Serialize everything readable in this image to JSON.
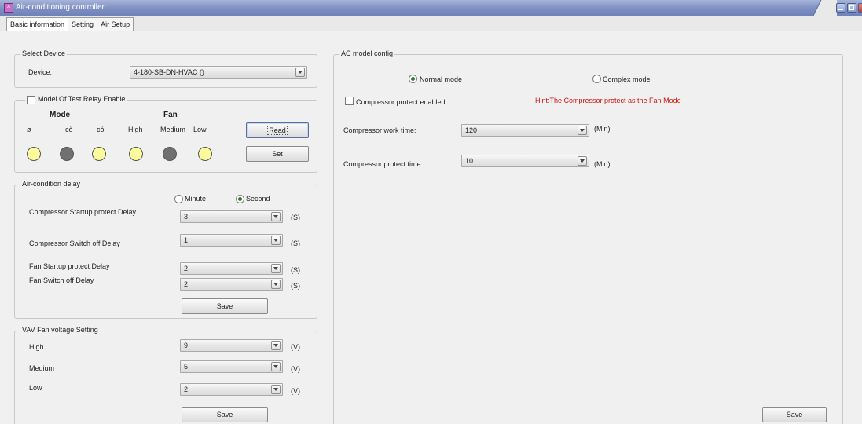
{
  "window": {
    "title": "Air-conditioning controller"
  },
  "tabs": [
    "Basic information",
    "Setting",
    "Air Setup"
  ],
  "select_device": {
    "title": "Select Device",
    "device_label": "Device:",
    "device_value": "4-180-SB-DN-HVAC ()"
  },
  "relay": {
    "checkbox_label": "Model Of Test Relay Enable",
    "mode_heading": "Mode",
    "fan_heading": "Fan",
    "channel_labels": [
      "ø̃",
      "cò",
      "có",
      "High",
      "Medium",
      "Low"
    ],
    "led_states": [
      "yellow",
      "gray",
      "yellow",
      "yellow",
      "gray",
      "yellow"
    ],
    "read_label": "Read",
    "set_label": "Set"
  },
  "delay": {
    "title": "Air-condition delay",
    "minute_label": "Minute",
    "second_label": "Second",
    "selected_unit": "Second",
    "rows": [
      {
        "label": "Compressor Startup protect Delay",
        "value": "3",
        "unit": "(S)"
      },
      {
        "label": "Compressor Switch off Delay",
        "value": "1",
        "unit": "(S)"
      },
      {
        "label": "Fan Startup protect  Delay",
        "value": "2",
        "unit": "(S)"
      },
      {
        "label": "Fan Switch off Delay",
        "value": "2",
        "unit": "(S)"
      }
    ],
    "save_label": "Save"
  },
  "vav": {
    "title": "VAV Fan voltage Setting",
    "rows": [
      {
        "label": "High",
        "value": "9",
        "unit": "(V)"
      },
      {
        "label": "Medium",
        "value": "5",
        "unit": "(V)"
      },
      {
        "label": "Low",
        "value": "2",
        "unit": "(V)"
      }
    ],
    "save_label": "Save"
  },
  "ac_model": {
    "title": "AC model config",
    "normal_mode_label": "Normal mode",
    "complex_mode_label": "Complex mode",
    "selected_mode": "Normal mode",
    "compressor_protect_label": "Compressor protect enabled",
    "hint": "Hint:The Compressor protect as the Fan Mode",
    "work_time_label": "Compressor work time:",
    "work_time_value": "120",
    "work_time_unit": "(Min)",
    "protect_time_label": "Compressor protect time:",
    "protect_time_value": "10",
    "protect_time_unit": "(Min)",
    "save_label": "Save"
  },
  "colors": {
    "titlebar": "#7d8fc2",
    "hint_text": "#d21010",
    "led_on": "#fbfb9c",
    "led_off": "#707070"
  }
}
